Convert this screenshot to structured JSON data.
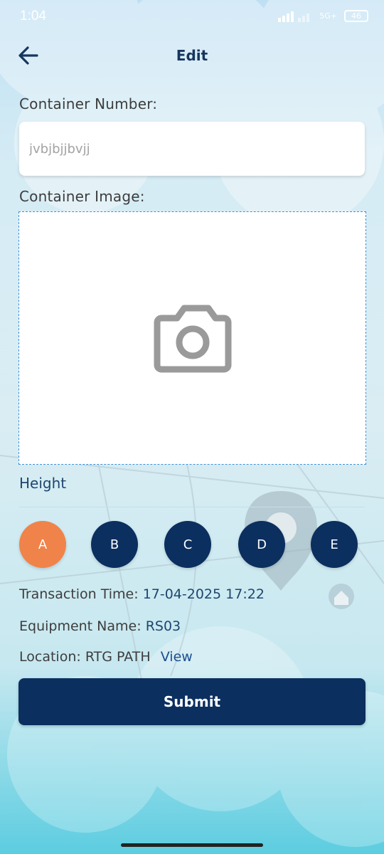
{
  "status_bar": {
    "time": "1:04",
    "network": "5G+",
    "battery": "46"
  },
  "app_bar": {
    "title": "Edit"
  },
  "form": {
    "container_number_label": "Container Number:",
    "container_number_placeholder": "jvbjbjjbvjj",
    "container_image_label": "Container Image:",
    "height_label": "Height",
    "height_options": [
      "A",
      "B",
      "C",
      "D",
      "E"
    ],
    "selected_height": "A"
  },
  "info": {
    "transaction_time_label": "Transaction Time:",
    "transaction_time_value": "17-04-2025 17:22",
    "equipment_name_label": "Equipment Name:",
    "equipment_name_value": "RS03",
    "location_label": "Location:",
    "location_value": "RTG PATH",
    "view_link": "View"
  },
  "submit_label": "Submit",
  "colors": {
    "primary": "#0b2f5f",
    "selected": "#f0834a",
    "dashed_border": "#3c8fd6"
  }
}
